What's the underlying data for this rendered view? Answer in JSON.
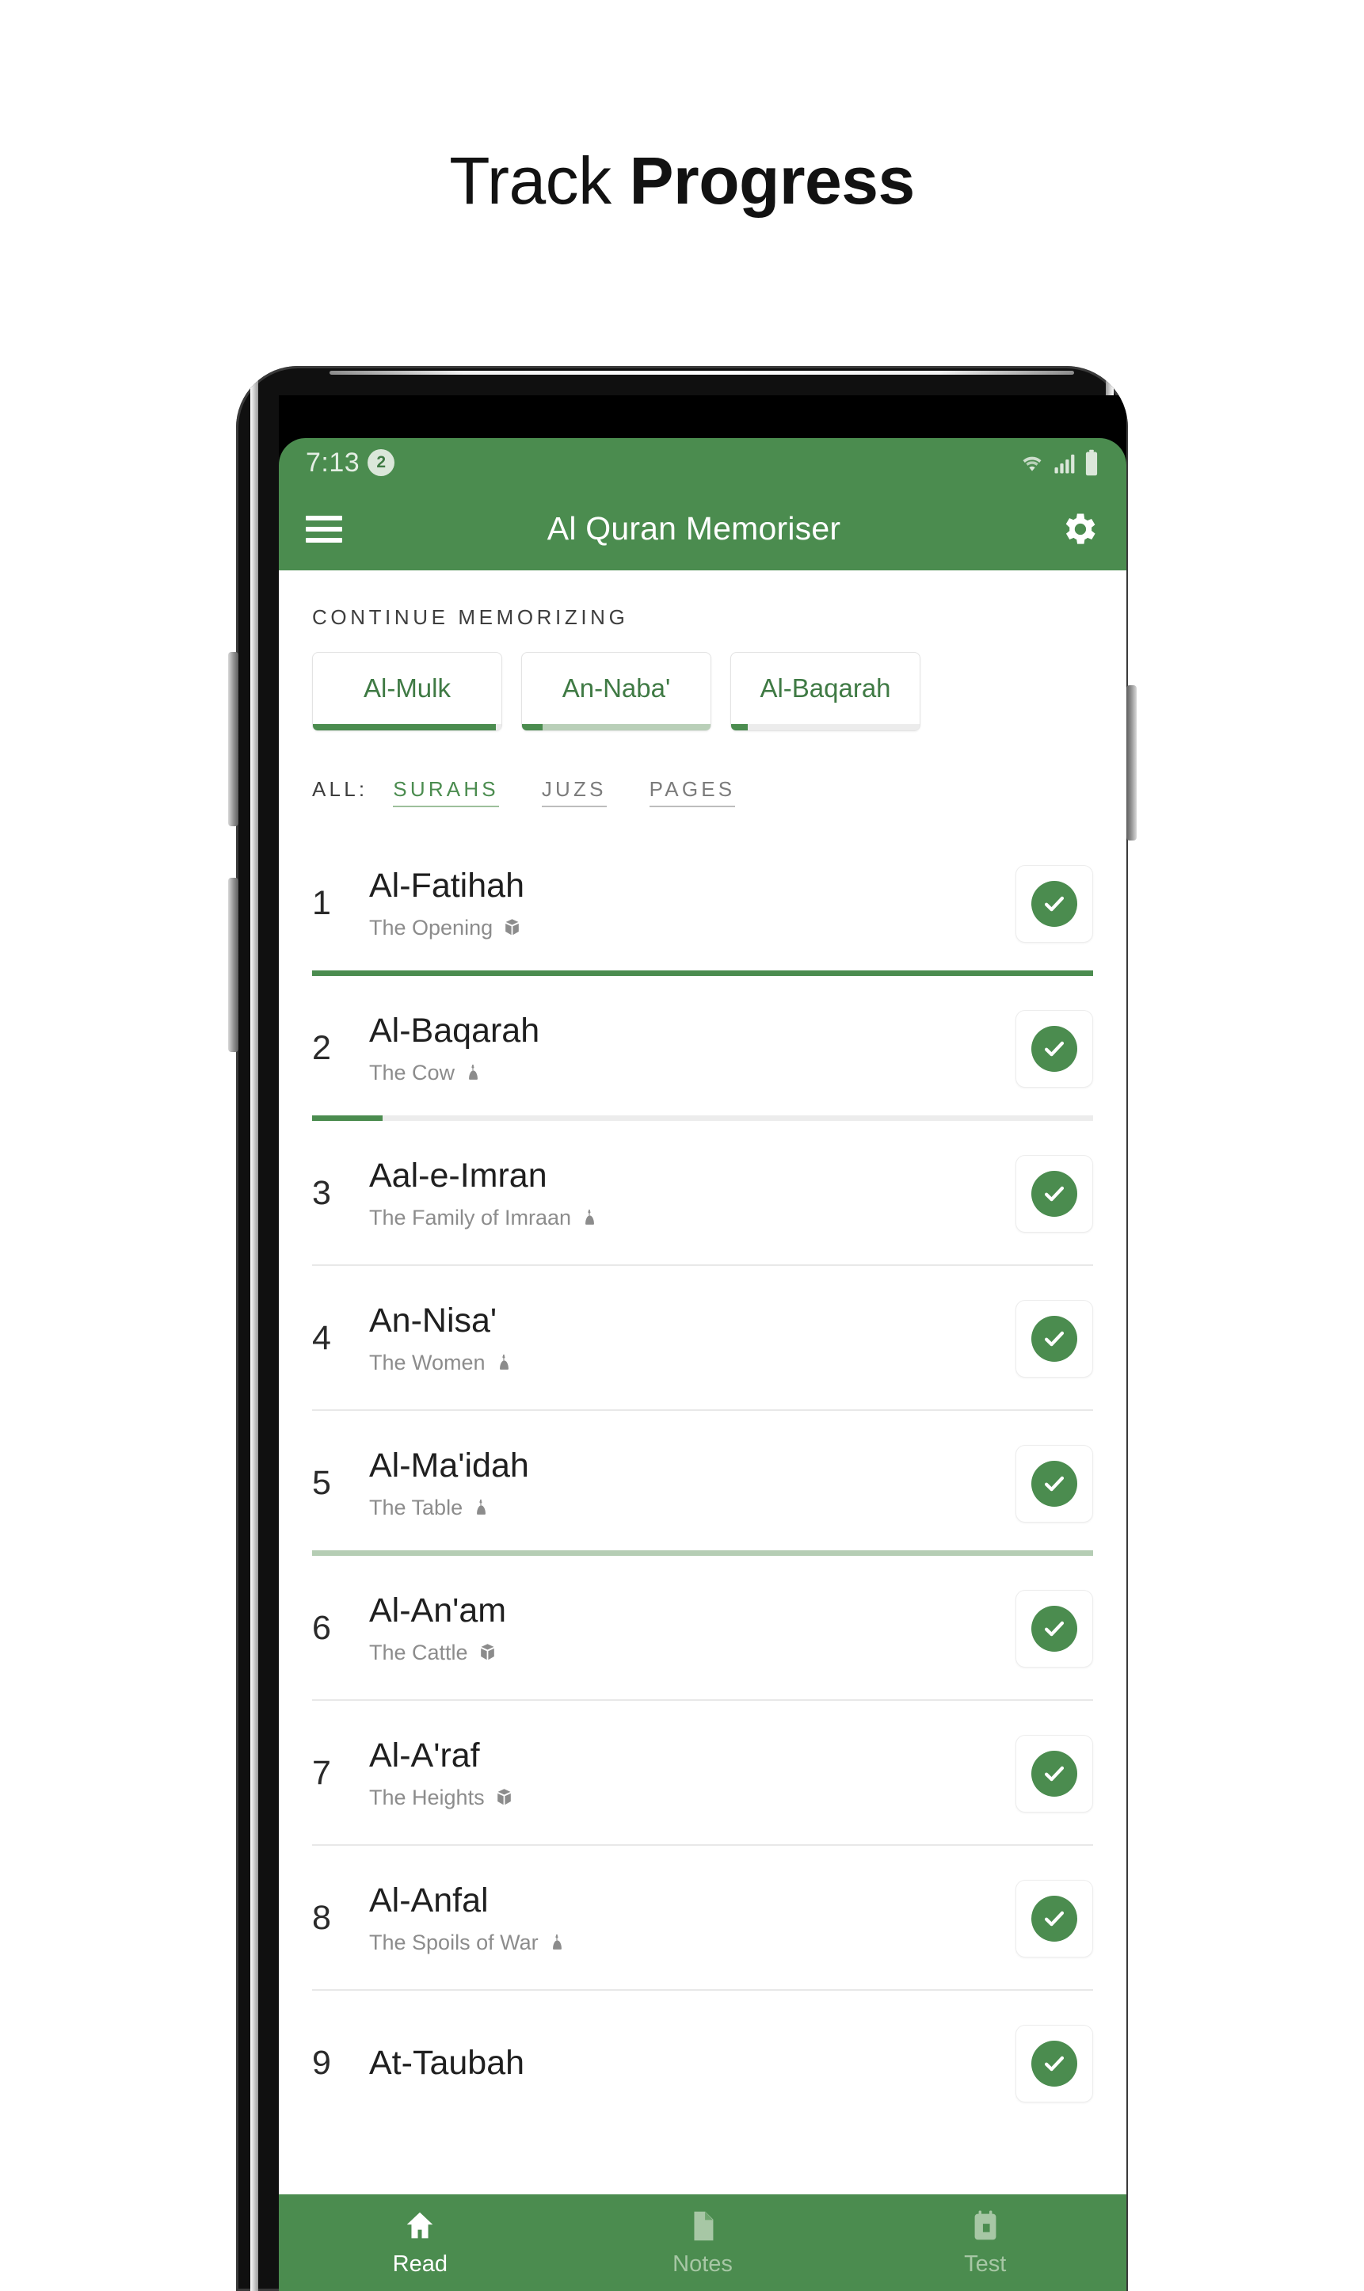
{
  "headline": {
    "light": "Track ",
    "bold": "Progress"
  },
  "phone": {
    "hardware": {
      "volume_up": "volume-up-button",
      "volume_down": "volume-down-button",
      "power": "power-button",
      "speaker": "earpiece-speaker"
    }
  },
  "statusbar": {
    "time": "7:13",
    "notification_count": "2",
    "icons": [
      "wifi-icon",
      "signal-icon",
      "battery-icon"
    ],
    "bg_color": "#4b8c4f"
  },
  "appbar": {
    "menu_icon": "hamburger-menu-icon",
    "title": "Al Quran Memoriser",
    "settings_icon": "gear-icon",
    "bg_color": "#4b8c4f"
  },
  "continue": {
    "label": "CONTINUE MEMORIZING",
    "cards": [
      {
        "name": "Al-Mulk",
        "progress": 97,
        "track": "gray"
      },
      {
        "name": "An-Naba'",
        "progress": 11,
        "track": "pale"
      },
      {
        "name": "Al-Baqarah",
        "progress": 9,
        "track": "gray"
      }
    ]
  },
  "filters": {
    "label": "ALL:",
    "options": [
      {
        "label": "SURAHS",
        "active": true
      },
      {
        "label": "JUZS",
        "active": false
      },
      {
        "label": "PAGES",
        "active": false
      }
    ]
  },
  "list": {
    "rows": [
      {
        "num": "1",
        "name": "Al-Fatihah",
        "subtitle": "The Opening",
        "revelation": "kaaba-icon",
        "checked": true,
        "divider": "bar",
        "progress": 100,
        "pale": false
      },
      {
        "num": "2",
        "name": "Al-Baqarah",
        "subtitle": "The Cow",
        "revelation": "minaret-icon",
        "checked": true,
        "divider": "bar",
        "progress": 9,
        "pale": false
      },
      {
        "num": "3",
        "name": "Aal-e-Imran",
        "subtitle": "The Family of Imraan",
        "revelation": "minaret-icon",
        "checked": true,
        "divider": "line",
        "progress": 0,
        "pale": false
      },
      {
        "num": "4",
        "name": "An-Nisa'",
        "subtitle": "The Women",
        "revelation": "minaret-icon",
        "checked": true,
        "divider": "line",
        "progress": 0,
        "pale": false
      },
      {
        "num": "5",
        "name": "Al-Ma'idah",
        "subtitle": "The Table",
        "revelation": "minaret-icon",
        "checked": true,
        "divider": "bar",
        "progress": 100,
        "pale": true
      },
      {
        "num": "6",
        "name": "Al-An'am",
        "subtitle": "The Cattle",
        "revelation": "kaaba-icon",
        "checked": true,
        "divider": "line",
        "progress": 0,
        "pale": false
      },
      {
        "num": "7",
        "name": "Al-A'raf",
        "subtitle": "The Heights",
        "revelation": "kaaba-icon",
        "checked": true,
        "divider": "line",
        "progress": 0,
        "pale": false
      },
      {
        "num": "8",
        "name": "Al-Anfal",
        "subtitle": "The Spoils of War",
        "revelation": "minaret-icon",
        "checked": true,
        "divider": "line",
        "progress": 0,
        "pale": false
      },
      {
        "num": "9",
        "name": "At-Taubah",
        "subtitle": "",
        "revelation": "",
        "checked": true,
        "divider": "none",
        "progress": 0,
        "pale": false
      }
    ]
  },
  "bottomnav": {
    "items": [
      {
        "label": "Read",
        "icon": "home-icon",
        "active": true
      },
      {
        "label": "Notes",
        "icon": "document-icon",
        "active": false
      },
      {
        "label": "Test",
        "icon": "calendar-icon",
        "active": false
      }
    ]
  },
  "colors": {
    "brand_green": "#4b8c4f",
    "pale_green": "#b5cdb4",
    "track_gray": "#ececec"
  }
}
